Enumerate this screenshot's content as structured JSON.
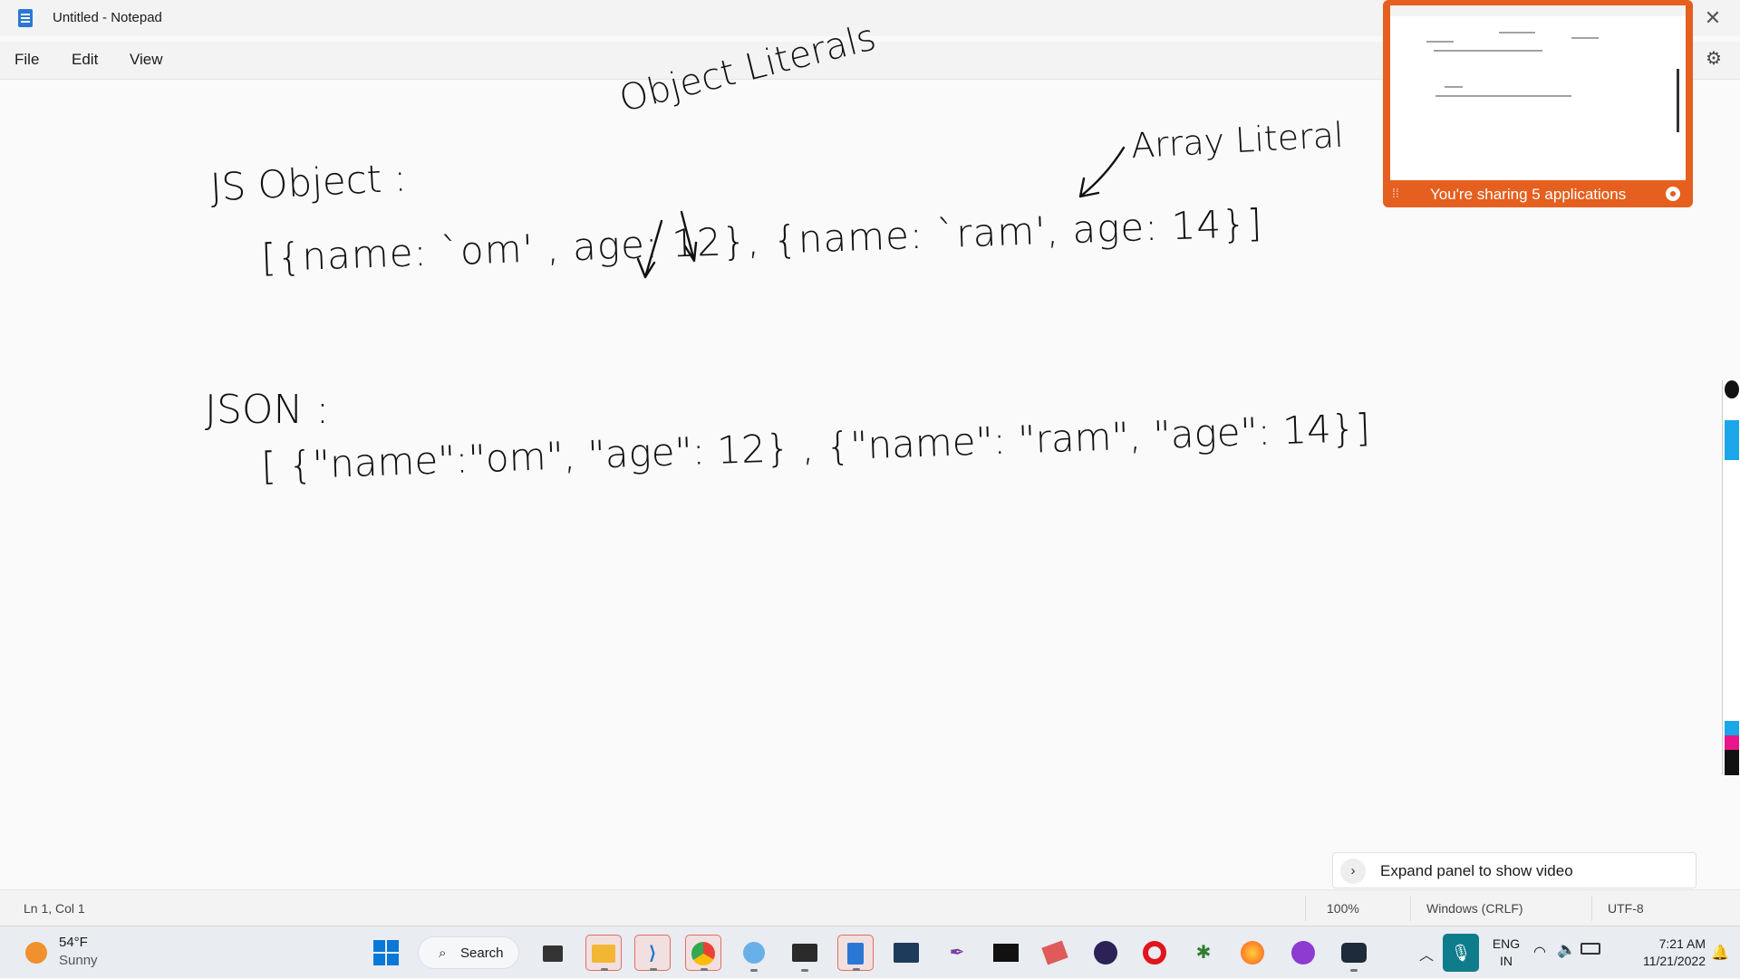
{
  "window": {
    "title": "Untitled - Notepad",
    "close_glyph": "✕"
  },
  "menu": {
    "file": "File",
    "edit": "Edit",
    "view": "View",
    "settings_icon": "gear-icon"
  },
  "note": {
    "object_literals": "Object Literals",
    "array_literal": "Array Literal",
    "js_object_heading": "JS Object :",
    "js_object_line": "[{name: `om' , age: 12}, {name: `ram', age: 14}]",
    "json_heading": "JSON :",
    "json_line": "[ {\"name\":\"om\", \"age\": 12} , {\"name\": \"ram\", \"age\": 14}]"
  },
  "share_panel": {
    "text": "You're sharing 5 applications"
  },
  "video_panel": {
    "expand_label": "Expand panel to show video"
  },
  "status": {
    "position": "Ln 1, Col 1",
    "zoom": "100%",
    "line_ending": "Windows (CRLF)",
    "encoding": "UTF-8"
  },
  "taskbar": {
    "weather_temp": "54°F",
    "weather_cond": "Sunny",
    "search_label": "Search",
    "lang_1": "ENG",
    "lang_2": "IN",
    "time": "7:21 AM",
    "date": "11/21/2022",
    "apps": [
      "windows-start",
      "file-explorer",
      "vscode",
      "chrome",
      "paint",
      "terminal",
      "notepad",
      "mysql",
      "feather",
      "cmd",
      "sticky",
      "eclipse",
      "opera",
      "anaconda",
      "firefox",
      "teams",
      "webex"
    ]
  }
}
